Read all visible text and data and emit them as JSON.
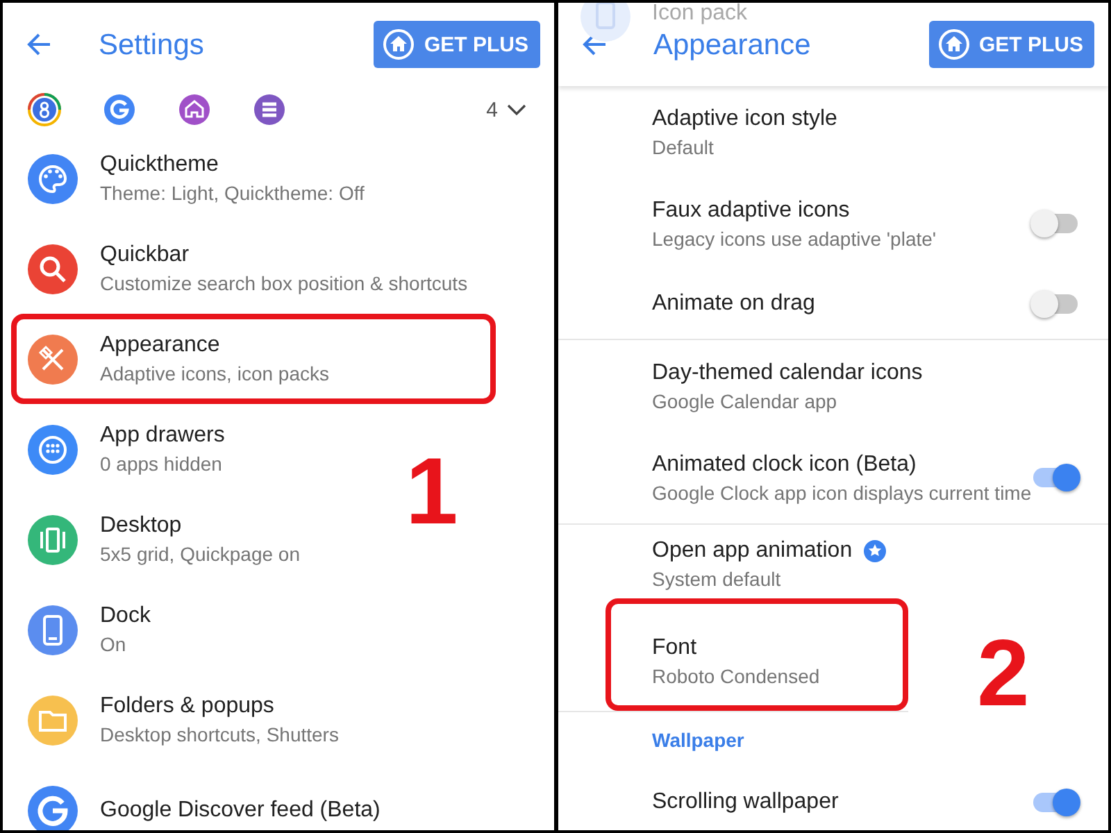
{
  "panels": [
    {
      "kind": "settings",
      "title": "Settings",
      "button": "GET PLUS",
      "callout": "1",
      "shortcuts": {
        "count": "4"
      },
      "items": [
        {
          "title": "Quicktheme",
          "subtitle": "Theme: Light, Quicktheme: Off",
          "color": "#4285f4",
          "highlighted": false
        },
        {
          "title": "Quickbar",
          "subtitle": "Customize search box position & shortcuts",
          "color": "#ea4335",
          "highlighted": false
        },
        {
          "title": "Appearance",
          "subtitle": "Adaptive icons, icon packs",
          "color": "#f07b4f",
          "highlighted": true
        },
        {
          "title": "App drawers",
          "subtitle": "0 apps hidden",
          "color": "#3d8af7",
          "highlighted": false
        },
        {
          "title": "Desktop",
          "subtitle": "5x5 grid, Quickpage on",
          "color": "#34b77a",
          "highlighted": false
        },
        {
          "title": "Dock",
          "subtitle": "On",
          "color": "#5b8def",
          "highlighted": false
        },
        {
          "title": "Folders & popups",
          "subtitle": "Desktop shortcuts, Shutters",
          "color": "#f7c04f",
          "highlighted": false
        },
        {
          "title": "Google Discover feed (Beta)",
          "color": "#4285f4",
          "highlighted": false
        }
      ]
    },
    {
      "kind": "appearance",
      "title": "Appearance",
      "faded_title": "Icon pack",
      "button": "GET PLUS",
      "callout": "2",
      "items": [
        {
          "kind": "plain",
          "title": "Adaptive icon style",
          "subtitle": "Default",
          "highlighted": false
        },
        {
          "kind": "toggle",
          "title": "Faux adaptive icons",
          "subtitle": "Legacy icons use adaptive 'plate'",
          "on": false
        },
        {
          "kind": "toggle",
          "title": "Animate on drag",
          "on": false,
          "divider": true
        },
        {
          "kind": "plain",
          "title": "Day-themed calendar icons",
          "subtitle": "Google Calendar app",
          "highlighted": false
        },
        {
          "kind": "toggle",
          "title": "Animated clock icon (Beta)",
          "subtitle": "Google Clock app icon displays current time",
          "on": true,
          "divider": true
        },
        {
          "kind": "plain",
          "title": "Open app animation",
          "subtitle": "System default",
          "badge": true,
          "highlighted": false
        },
        {
          "kind": "plain",
          "title": "Font",
          "subtitle": "Roboto Condensed",
          "highlighted": true,
          "divider": true
        },
        {
          "kind": "header",
          "title": "Wallpaper"
        },
        {
          "kind": "toggle",
          "title": "Scrolling wallpaper",
          "on": true
        }
      ]
    }
  ]
}
